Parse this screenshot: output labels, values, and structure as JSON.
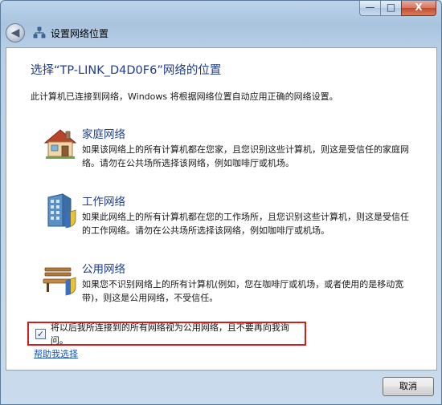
{
  "window": {
    "title": "设置网络位置",
    "caption_buttons": {
      "minimize": "—",
      "maximize": "□",
      "close": "X"
    },
    "back_glyph": "◀"
  },
  "main": {
    "heading": "选择“TP-LINK_D4D0F6”网络的位置",
    "intro": "此计算机已连接到网络，Windows 将根据网络位置自动应用正确的网络设置。",
    "options": [
      {
        "icon": "house-icon",
        "title": "家庭网络",
        "description": "如果该网络上的所有计算机都在您家，且您识别这些计算机，则这是受信任的家庭网络。请勿在公共场所选择该网络，例如咖啡厅或机场。"
      },
      {
        "icon": "office-building-icon",
        "title": "工作网络",
        "description": "如果此网络上的所有计算机都在您的工作场所，且您识别这些计算机，则这是受信任的工作网络。请勿在公共场所选择该网络，例如咖啡厅或机场。"
      },
      {
        "icon": "park-bench-icon",
        "title": "公用网络",
        "description": "如果您不识别网络上的所有计算机(例如，您在咖啡厅或机场，或者使用的是移动宽带)，则这是公用网络，不受信任。"
      }
    ],
    "checkbox": {
      "checked": true,
      "check_glyph": "✓",
      "label": "将以后我所连接到的所有网络视为公用网络，且不要再向我询问。"
    },
    "help_link": "帮助我选择"
  },
  "footer": {
    "cancel_label": "取消"
  },
  "colors": {
    "heading": "#1f3d8a",
    "link": "#1a55b8",
    "highlight_border": "#d11e1e"
  }
}
